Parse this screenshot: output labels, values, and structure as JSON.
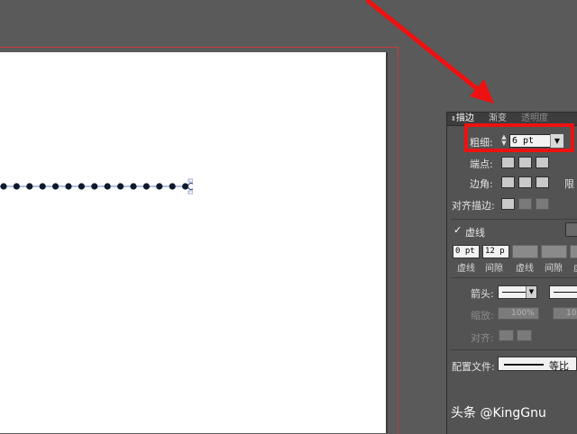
{
  "panel": {
    "tabs": [
      {
        "label": "描边",
        "active": true
      },
      {
        "label": "渐变",
        "active": false
      },
      {
        "label": "透明度",
        "active": false
      }
    ],
    "weight": {
      "label": "粗细:",
      "value": "6 pt"
    },
    "cap": {
      "label": "端点:"
    },
    "corner": {
      "label": "边角:",
      "limit_label": "限"
    },
    "align": {
      "label": "对齐描边:"
    },
    "dashed": {
      "label": "虚线",
      "checked": true
    },
    "dashes": [
      {
        "value": "0 pt",
        "label": "虚线"
      },
      {
        "value": "12 p",
        "label": "间隙"
      },
      {
        "value": "",
        "label": "虚线"
      },
      {
        "value": "",
        "label": "间隙"
      },
      {
        "value": "",
        "label": "虚"
      }
    ],
    "arrowheads": {
      "label": "箭头:"
    },
    "scale": {
      "label": "缩放:",
      "value_left": "100%",
      "value_right": "10"
    },
    "align_arrows": {
      "label": "对齐:"
    },
    "profile": {
      "label": "配置文件:",
      "value": "等比"
    }
  },
  "watermark": "头条 @KingGnu",
  "colors": {
    "highlight": "#ee1111",
    "arrow": "#ee1111",
    "artboard_border": "#c83a3a",
    "dot": "#0d1a2e"
  },
  "icons": {
    "checkbox": "check-icon",
    "spinner": "up-down-spinner-icon",
    "dropdown": "chevron-down-icon"
  }
}
